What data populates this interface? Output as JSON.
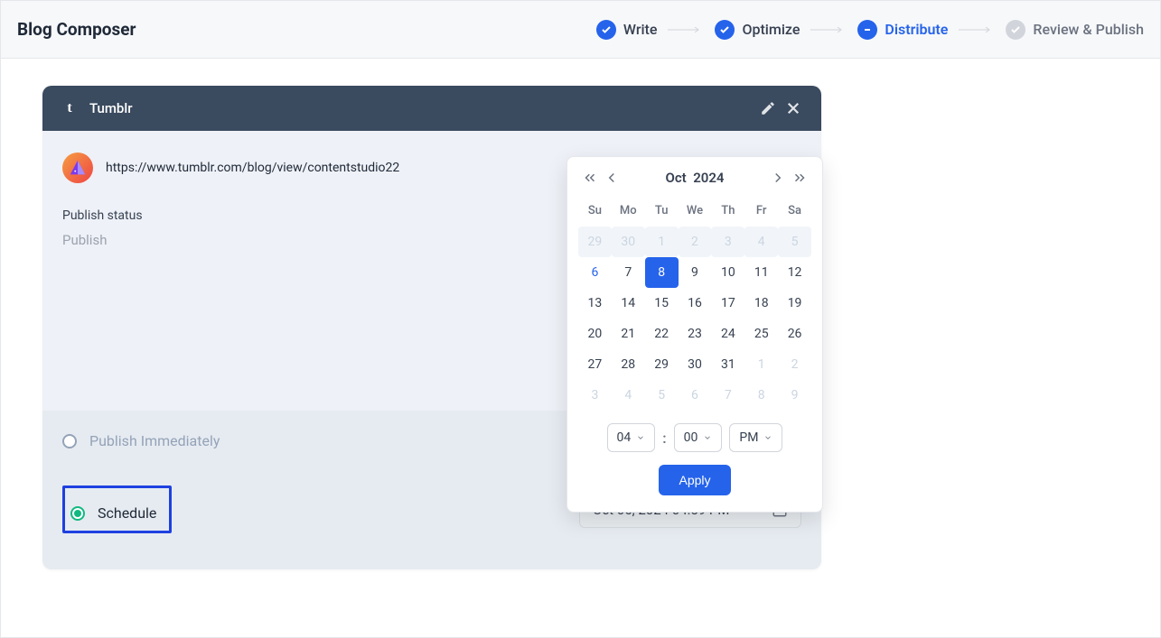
{
  "header": {
    "title": "Blog Composer",
    "steps": [
      {
        "label": "Write",
        "state": "complete"
      },
      {
        "label": "Optimize",
        "state": "complete"
      },
      {
        "label": "Distribute",
        "state": "active"
      },
      {
        "label": "Review & Publish",
        "state": "inactive"
      }
    ]
  },
  "card": {
    "platform": "Tumblr",
    "url": "https://www.tumblr.com/blog/view/contentstudio22",
    "status_label": "Publish status",
    "status_value": "Publish"
  },
  "footer": {
    "immediate_label": "Publish Immediately",
    "schedule_label": "Schedule",
    "date_value": "Oct 06, 2024 04:59 PM"
  },
  "datepicker": {
    "month": "Oct",
    "year": "2024",
    "dow": [
      "Su",
      "Mo",
      "Tu",
      "We",
      "Th",
      "Fr",
      "Sa"
    ],
    "days": [
      {
        "n": "29",
        "cls": "muted highlighted-row"
      },
      {
        "n": "30",
        "cls": "muted highlighted-row"
      },
      {
        "n": "1",
        "cls": "muted highlighted-row"
      },
      {
        "n": "2",
        "cls": "muted highlighted-row"
      },
      {
        "n": "3",
        "cls": "muted highlighted-row"
      },
      {
        "n": "4",
        "cls": "muted highlighted-row"
      },
      {
        "n": "5",
        "cls": "muted highlighted-row"
      },
      {
        "n": "6",
        "cls": "link"
      },
      {
        "n": "7",
        "cls": ""
      },
      {
        "n": "8",
        "cls": "selected"
      },
      {
        "n": "9",
        "cls": ""
      },
      {
        "n": "10",
        "cls": ""
      },
      {
        "n": "11",
        "cls": ""
      },
      {
        "n": "12",
        "cls": ""
      },
      {
        "n": "13",
        "cls": ""
      },
      {
        "n": "14",
        "cls": ""
      },
      {
        "n": "15",
        "cls": ""
      },
      {
        "n": "16",
        "cls": ""
      },
      {
        "n": "17",
        "cls": ""
      },
      {
        "n": "18",
        "cls": ""
      },
      {
        "n": "19",
        "cls": ""
      },
      {
        "n": "20",
        "cls": ""
      },
      {
        "n": "21",
        "cls": ""
      },
      {
        "n": "22",
        "cls": ""
      },
      {
        "n": "23",
        "cls": ""
      },
      {
        "n": "24",
        "cls": ""
      },
      {
        "n": "25",
        "cls": ""
      },
      {
        "n": "26",
        "cls": ""
      },
      {
        "n": "27",
        "cls": ""
      },
      {
        "n": "28",
        "cls": ""
      },
      {
        "n": "29",
        "cls": ""
      },
      {
        "n": "30",
        "cls": ""
      },
      {
        "n": "31",
        "cls": ""
      },
      {
        "n": "1",
        "cls": "muted"
      },
      {
        "n": "2",
        "cls": "muted"
      },
      {
        "n": "3",
        "cls": "muted"
      },
      {
        "n": "4",
        "cls": "muted"
      },
      {
        "n": "5",
        "cls": "muted"
      },
      {
        "n": "6",
        "cls": "muted"
      },
      {
        "n": "7",
        "cls": "muted"
      },
      {
        "n": "8",
        "cls": "muted"
      },
      {
        "n": "9",
        "cls": "muted"
      }
    ],
    "hour": "04",
    "minute": "00",
    "ampm": "PM",
    "apply_label": "Apply"
  }
}
